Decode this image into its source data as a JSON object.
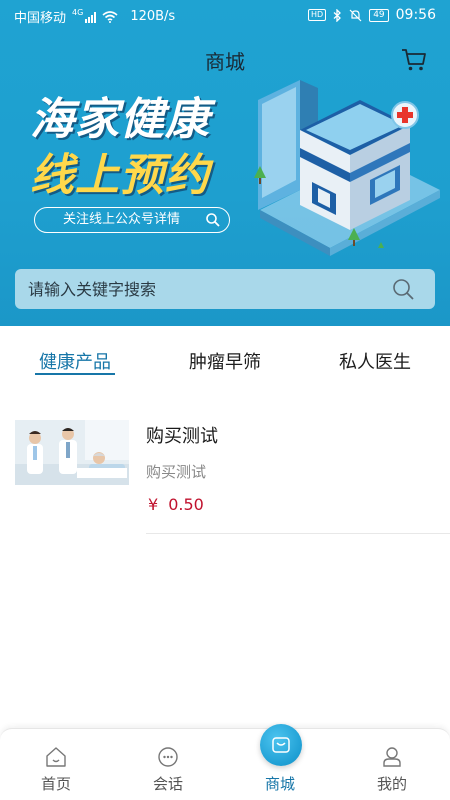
{
  "status_bar": {
    "carrier": "中国移动",
    "network": "4G",
    "speed": "120B/s",
    "battery": "49",
    "time": "09:56"
  },
  "header": {
    "title": "商城"
  },
  "banner": {
    "line1": "海家健康",
    "line2": "线上预约",
    "follow_text": "关注线上公众号详情"
  },
  "search": {
    "placeholder": "请输入关键字搜索"
  },
  "tabs": [
    {
      "label": "健康产品",
      "active": true
    },
    {
      "label": "肿瘤早筛",
      "active": false
    },
    {
      "label": "私人医生",
      "active": false
    }
  ],
  "products": [
    {
      "name": "购买测试",
      "subtitle": "购买测试",
      "currency": "¥",
      "price": "0.50"
    }
  ],
  "bottom_nav": [
    {
      "label": "首页",
      "icon": "home-icon"
    },
    {
      "label": "会话",
      "icon": "chat-icon"
    },
    {
      "label": "商城",
      "icon": "shopping-bag-icon",
      "active": true
    },
    {
      "label": "我的",
      "icon": "user-icon"
    }
  ],
  "colors": {
    "header_blue": "#1fa3d2",
    "accent": "#1776a8",
    "price_red": "#c0122e",
    "banner_yellow": "#ffd84b"
  }
}
